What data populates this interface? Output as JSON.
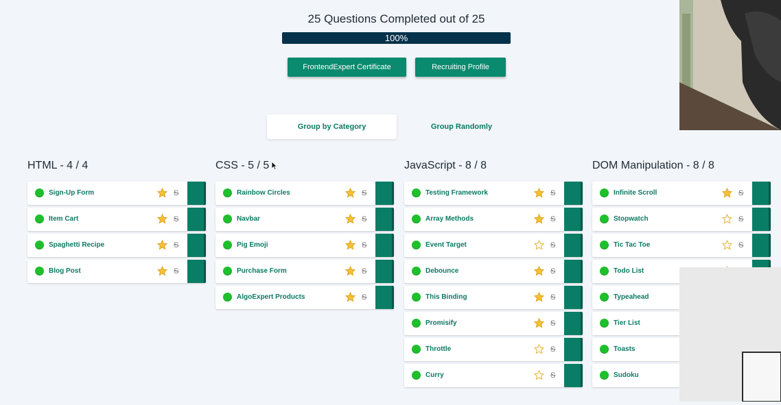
{
  "progress": {
    "title": "25 Questions Completed out of 25",
    "percent_label": "100%",
    "completed": 25,
    "total": 25,
    "fraction": 1.0
  },
  "actions": {
    "certificate_label": "FrontendExpert Certificate",
    "profile_label": "Recruiting Profile"
  },
  "grouping": {
    "by_category_label": "Group by Category",
    "randomly_label": "Group Randomly",
    "selected": "by_category"
  },
  "categories": [
    {
      "title": "HTML - 4 / 4",
      "questions": [
        {
          "name": "Sign-Up Form",
          "starred": true
        },
        {
          "name": "Item Cart",
          "starred": true
        },
        {
          "name": "Spaghetti Recipe",
          "starred": true
        },
        {
          "name": "Blog Post",
          "starred": true
        }
      ]
    },
    {
      "title": "CSS - 5 / 5",
      "questions": [
        {
          "name": "Rainbow Circles",
          "starred": true
        },
        {
          "name": "Navbar",
          "starred": true
        },
        {
          "name": "Pig Emoji",
          "starred": true
        },
        {
          "name": "Purchase Form",
          "starred": true
        },
        {
          "name": "AlgoExpert Products",
          "starred": true
        }
      ]
    },
    {
      "title": "JavaScript - 8 / 8",
      "questions": [
        {
          "name": "Testing Framework",
          "starred": true
        },
        {
          "name": "Array Methods",
          "starred": true
        },
        {
          "name": "Event Target",
          "starred": false
        },
        {
          "name": "Debounce",
          "starred": true
        },
        {
          "name": "This Binding",
          "starred": true
        },
        {
          "name": "Promisify",
          "starred": true
        },
        {
          "name": "Throttle",
          "starred": false
        },
        {
          "name": "Curry",
          "starred": false
        }
      ]
    },
    {
      "title": "DOM Manipulation - 8 / 8",
      "questions": [
        {
          "name": "Infinite Scroll",
          "starred": true
        },
        {
          "name": "Stopwatch",
          "starred": false
        },
        {
          "name": "Tic Tac Toe",
          "starred": false
        },
        {
          "name": "Todo List",
          "starred": false
        },
        {
          "name": "Typeahead",
          "starred": false
        },
        {
          "name": "Tier List",
          "starred": false
        },
        {
          "name": "Toasts",
          "starred": false
        },
        {
          "name": "Sudoku",
          "starred": false
        }
      ]
    }
  ],
  "icons": {
    "completed": "green-circle-icon",
    "star": "star-icon",
    "strike": "strikethrough-s-icon"
  },
  "colors": {
    "accent": "#0a8a6f",
    "progress_fill": "#05324a",
    "completed_dot": "#1ec02c",
    "star_filled": "#f5c13a",
    "star_outline": "#e6b84a"
  }
}
